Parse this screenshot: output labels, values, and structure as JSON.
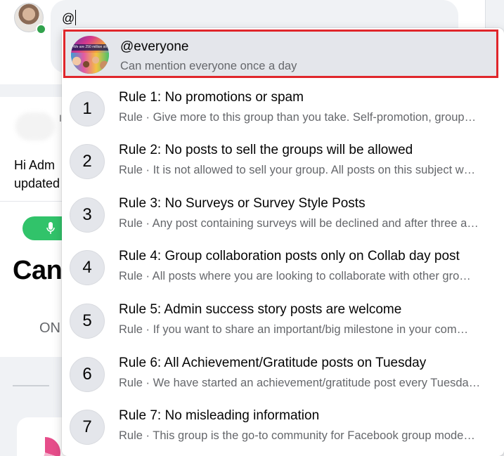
{
  "composer": {
    "input_value": "@"
  },
  "background": {
    "partial_initial": "I",
    "post_text_line1": "Hi Adm",
    "post_text_line2": "updated",
    "heading_fragment": "Can",
    "tab_fragment": "ON"
  },
  "mentions": {
    "everyone": {
      "title": "@everyone",
      "subtitle": "Can mention everyone once a day",
      "thumb_text": "We are 250 million strong"
    },
    "rules": [
      {
        "number": "1",
        "title": "Rule 1: No promotions or spam",
        "subtitle": "Rule · Give more to this group than you take. Self-promotion, group…"
      },
      {
        "number": "2",
        "title": "Rule 2: No posts to sell the groups will be allowed",
        "subtitle": "Rule · It is not allowed to sell your group. All posts on this subject w…"
      },
      {
        "number": "3",
        "title": "Rule 3: No Surveys or Survey Style Posts",
        "subtitle": "Rule · Any post containing surveys will be declined and after three a…"
      },
      {
        "number": "4",
        "title": "Rule 4: Group collaboration posts only on Collab day post",
        "subtitle": "Rule · All posts where you are looking to collaborate with other gro…"
      },
      {
        "number": "5",
        "title": "Rule 5: Admin success story posts are welcome",
        "subtitle": "Rule · If you want to share an important/big milestone in your com…"
      },
      {
        "number": "6",
        "title": "Rule 6: All Achievement/Gratitude posts on Tuesday",
        "subtitle": "Rule · We have started an achievement/gratitude post every Tuesda…"
      },
      {
        "number": "7",
        "title": "Rule 7: No misleading information",
        "subtitle": "Rule · This group is the go-to community for Facebook group mode…"
      }
    ]
  },
  "colors": {
    "highlight_border": "#e0262b",
    "selected_bg": "#e4e6eb",
    "online_green": "#31a24c"
  }
}
